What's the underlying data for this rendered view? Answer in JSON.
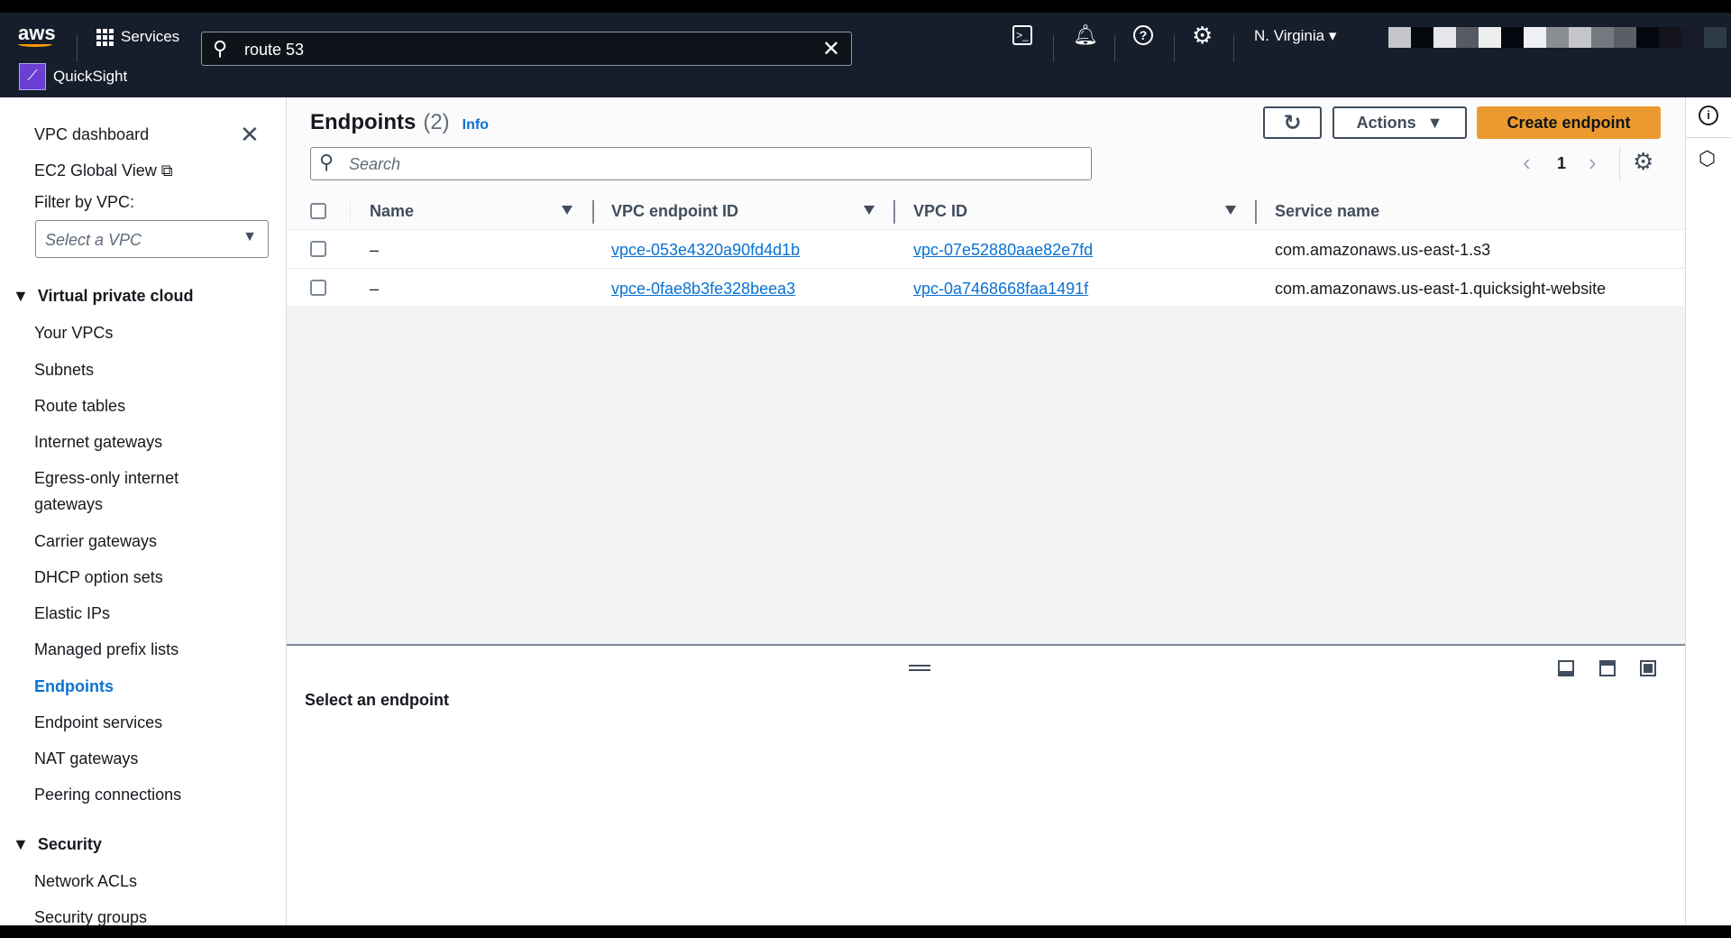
{
  "topbar": {
    "services": "Services",
    "search_value": "route 53",
    "region": "N. Virginia",
    "favorite": "QuickSight"
  },
  "sidebar": {
    "dashboard": "VPC dashboard",
    "ec2_global": "EC2 Global View",
    "filter_label": "Filter by VPC:",
    "filter_placeholder": "Select a VPC",
    "sections": [
      {
        "title": "Virtual private cloud",
        "items": [
          "Your VPCs",
          "Subnets",
          "Route tables",
          "Internet gateways",
          "Egress-only internet",
          "gateways",
          "Carrier gateways",
          "DHCP option sets",
          "Elastic IPs",
          "Managed prefix lists",
          "Endpoints",
          "Endpoint services",
          "NAT gateways",
          "Peering connections"
        ]
      },
      {
        "title": "Security",
        "items": [
          "Network ACLs",
          "Security groups"
        ]
      }
    ],
    "active": "Endpoints"
  },
  "main": {
    "title": "Endpoints",
    "count": "(2)",
    "info": "Info",
    "actions": "Actions",
    "create": "Create endpoint",
    "search_placeholder": "Search",
    "page": "1",
    "columns": [
      "Name",
      "VPC endpoint ID",
      "VPC ID",
      "Service name"
    ],
    "rows": [
      {
        "name": "–",
        "endpoint_id": "vpce-053e4320a90fd4d1b",
        "vpc_id": "vpc-07e52880aae82e7fd",
        "service": "com.amazonaws.us-east-1.s3"
      },
      {
        "name": "–",
        "endpoint_id": "vpce-0fae8b3fe328beea3",
        "vpc_id": "vpc-0a7468668faa1491f",
        "service": "com.amazonaws.us-east-1.quicksight-website"
      }
    ],
    "detail_empty": "Select an endpoint"
  },
  "colors": {
    "accent": "#0972d3",
    "primary_button": "#ec9a2f",
    "header": "#161d2b"
  }
}
